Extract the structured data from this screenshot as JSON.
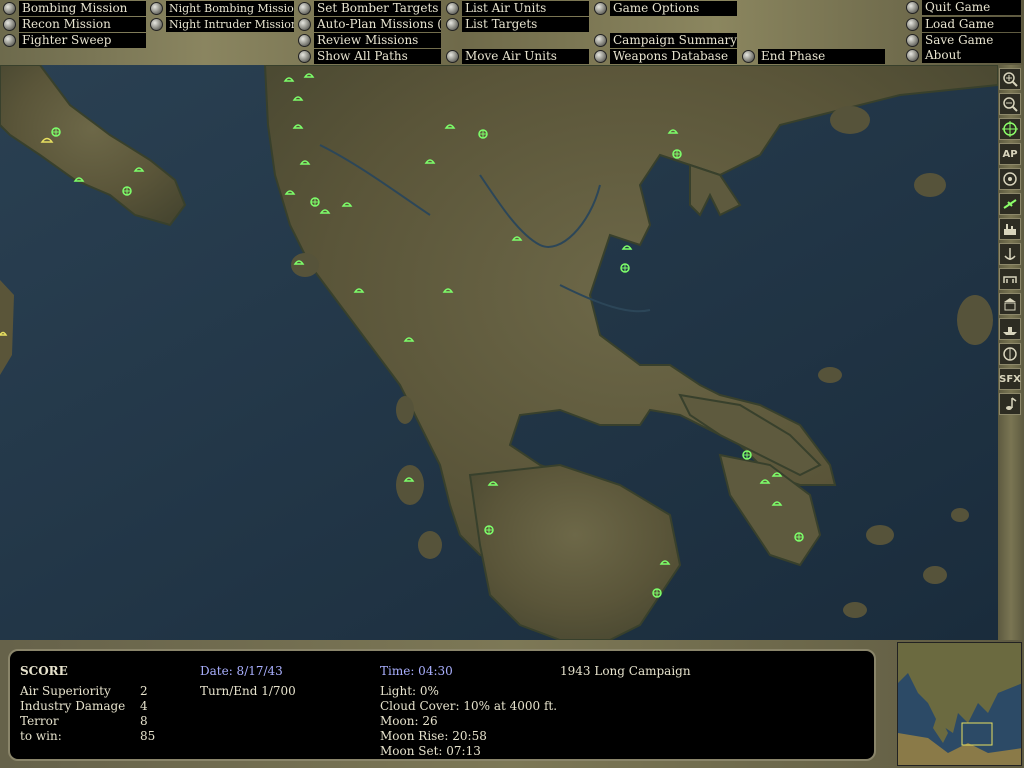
{
  "menu": {
    "col1": [
      "Bombing Mission",
      "Recon Mission",
      "Fighter Sweep"
    ],
    "col2": [
      "Night Bombing Mission",
      "Night Intruder Mission"
    ],
    "col3": [
      "Set Bomber Targets",
      "Auto-Plan Missions (Off)",
      "Review Missions",
      "Show All Paths"
    ],
    "col4": [
      "List Air Units",
      "List Targets",
      "Move Air Units"
    ],
    "col5": [
      "Game Options",
      "Campaign Summary",
      "Weapons Database"
    ],
    "end_phase": "End Phase",
    "col6": [
      "Quit Game",
      "Load Game",
      "Save Game",
      "About"
    ]
  },
  "toolbar": {
    "icons": [
      "zoom-in-icon",
      "zoom-out-icon",
      "crosshair-icon",
      "ap-icon",
      "target-icon",
      "aircraft-icon",
      "factory-icon",
      "anchor-icon",
      "bridge-icon",
      "building-icon",
      "ship-icon",
      "radar-icon",
      "sfx-icon",
      "music-icon"
    ],
    "ap_label": "AP",
    "sfx_label": "SFX",
    "active_color": "#8cff6a"
  },
  "score": {
    "heading": "SCORE",
    "rows": [
      {
        "label": "Air Superiority",
        "value": "2"
      },
      {
        "label": "Industry Damage",
        "value": "4"
      },
      {
        "label": "Terror",
        "value": "8"
      },
      {
        "label": "to win:",
        "value": "85"
      }
    ]
  },
  "date": {
    "text": "Date: 8/17/43",
    "turn": "Turn/End 1/700"
  },
  "time": {
    "text": "Time: 04:30"
  },
  "conditions": [
    "Light: 0%",
    "Cloud Cover: 10% at 4000 ft.",
    "Moon: 26",
    "Moon Rise: 20:58",
    "Moon Set: 07:13"
  ],
  "campaign": "1943 Long Campaign",
  "colors": {
    "accent_blue": "#aab0ff",
    "unit_green": "#7dff6a",
    "unit_yellow": "#e8e060",
    "sea": "#1f3344",
    "land": "#5e5a3e"
  }
}
